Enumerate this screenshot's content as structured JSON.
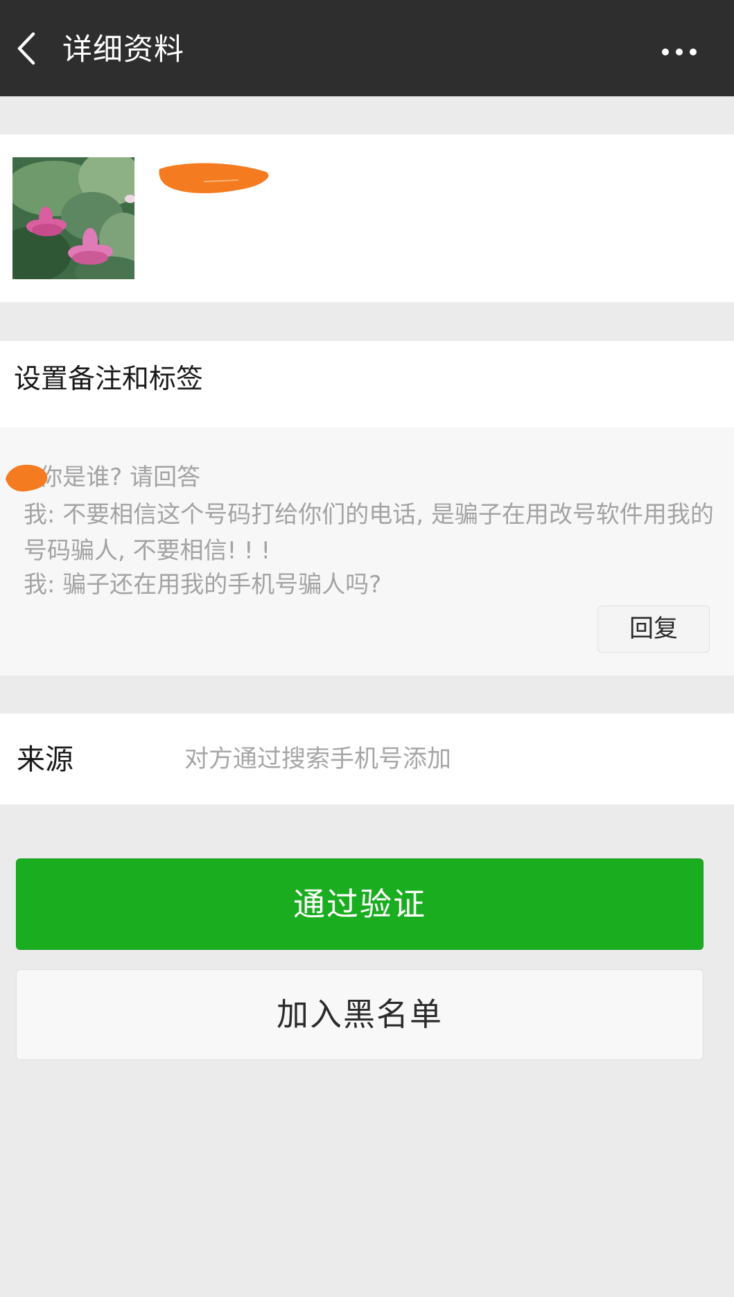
{
  "header": {
    "title": "详细资料",
    "back_icon": "chevron-left-icon",
    "more_icon": "more-horizontal-icon"
  },
  "profile": {
    "avatar": "lotus-photo-avatar",
    "name_redacted": true,
    "redaction_color": "#f47b20"
  },
  "remark": {
    "label": "设置备注和标签"
  },
  "messages": [
    {
      "sender": "我",
      "text": ": 你是谁? 请回答",
      "sender_redacted": true
    },
    {
      "sender": "我",
      "text": "我: 不要相信这个号码打给你们的电话, 是骗子在用改号软件用我的号码骗人, 不要相信! ! !"
    },
    {
      "sender": "我",
      "text": "我: 骗子还在用我的手机号骗人吗?"
    }
  ],
  "reply_button": "回复",
  "source": {
    "label": "来源",
    "value": "对方通过搜索手机号添加"
  },
  "actions": {
    "verify_label": "通过验证",
    "blacklist_label": "加入黑名单"
  },
  "colors": {
    "topbar": "#2e2e2e",
    "primary_green": "#1aad1f",
    "background": "#ebebeb"
  }
}
